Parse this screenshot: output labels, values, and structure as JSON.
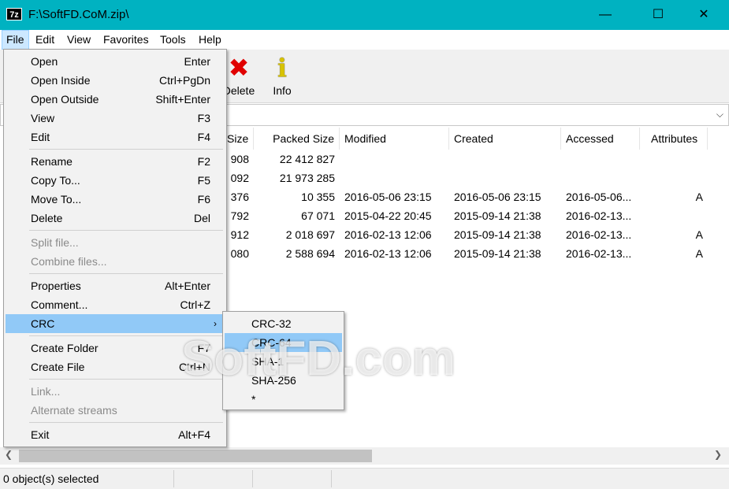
{
  "window": {
    "icon_text": "7z",
    "title": "F:\\SoftFD.CoM.zip\\",
    "min_glyph": "—",
    "max_glyph": "☐",
    "close_glyph": "✕"
  },
  "menubar": [
    "File",
    "Edit",
    "View",
    "Favorites",
    "Tools",
    "Help"
  ],
  "toolbar": {
    "delete_label": "Delete",
    "delete_icon": "✖",
    "info_label": "Info",
    "info_icon": "i"
  },
  "address": {
    "dropdown_glyph": "⌵"
  },
  "list": {
    "columns": [
      "Size",
      "Packed Size",
      "Modified",
      "Created",
      "Accessed",
      "Attributes"
    ],
    "rows": [
      {
        "size": "908",
        "packed": "22 412 827",
        "modified": "",
        "created": "",
        "accessed": "",
        "attr": ""
      },
      {
        "size": "092",
        "packed": "21 973 285",
        "modified": "",
        "created": "",
        "accessed": "",
        "attr": ""
      },
      {
        "size": "376",
        "packed": "10 355",
        "modified": "2016-05-06 23:15",
        "created": "2016-05-06 23:15",
        "accessed": "2016-05-06...",
        "attr": "A"
      },
      {
        "size": "792",
        "packed": "67 071",
        "modified": "2015-04-22 20:45",
        "created": "2015-09-14 21:38",
        "accessed": "2016-02-13...",
        "attr": ""
      },
      {
        "size": "912",
        "packed": "2 018 697",
        "modified": "2016-02-13 12:06",
        "created": "2015-09-14 21:38",
        "accessed": "2016-02-13...",
        "attr": "A"
      },
      {
        "size": "080",
        "packed": "2 588 694",
        "modified": "2016-02-13 12:06",
        "created": "2015-09-14 21:38",
        "accessed": "2016-02-13...",
        "attr": "A"
      }
    ]
  },
  "file_menu": {
    "items": [
      {
        "label": "Open",
        "shortcut": "Enter"
      },
      {
        "label": "Open Inside",
        "shortcut": "Ctrl+PgDn"
      },
      {
        "label": "Open Outside",
        "shortcut": "Shift+Enter"
      },
      {
        "label": "View",
        "shortcut": "F3"
      },
      {
        "label": "Edit",
        "shortcut": "F4"
      },
      {
        "label": "Rename",
        "shortcut": "F2"
      },
      {
        "label": "Copy To...",
        "shortcut": "F5"
      },
      {
        "label": "Move To...",
        "shortcut": "F6"
      },
      {
        "label": "Delete",
        "shortcut": "Del"
      },
      {
        "label": "Split file...",
        "shortcut": ""
      },
      {
        "label": "Combine files...",
        "shortcut": ""
      },
      {
        "label": "Properties",
        "shortcut": "Alt+Enter"
      },
      {
        "label": "Comment...",
        "shortcut": "Ctrl+Z"
      },
      {
        "label": "CRC",
        "shortcut": ""
      },
      {
        "label": "Create Folder",
        "shortcut": "F7"
      },
      {
        "label": "Create File",
        "shortcut": "Ctrl+N"
      },
      {
        "label": "Link...",
        "shortcut": ""
      },
      {
        "label": "Alternate streams",
        "shortcut": ""
      },
      {
        "label": "Exit",
        "shortcut": "Alt+F4"
      }
    ],
    "submenu_arrow": "›"
  },
  "crc_menu": [
    "CRC-32",
    "CRC-64",
    "SHA-1",
    "SHA-256",
    "*"
  ],
  "scroll": {
    "left_arrow": "❮",
    "right_arrow": "❯"
  },
  "status": {
    "selected": "0 object(s) selected"
  },
  "watermark": "SoftFD.com",
  "colors": {
    "titlebar": "#00b2c1",
    "highlight": "#91c9f7",
    "menu_active": "#cce8ff"
  }
}
